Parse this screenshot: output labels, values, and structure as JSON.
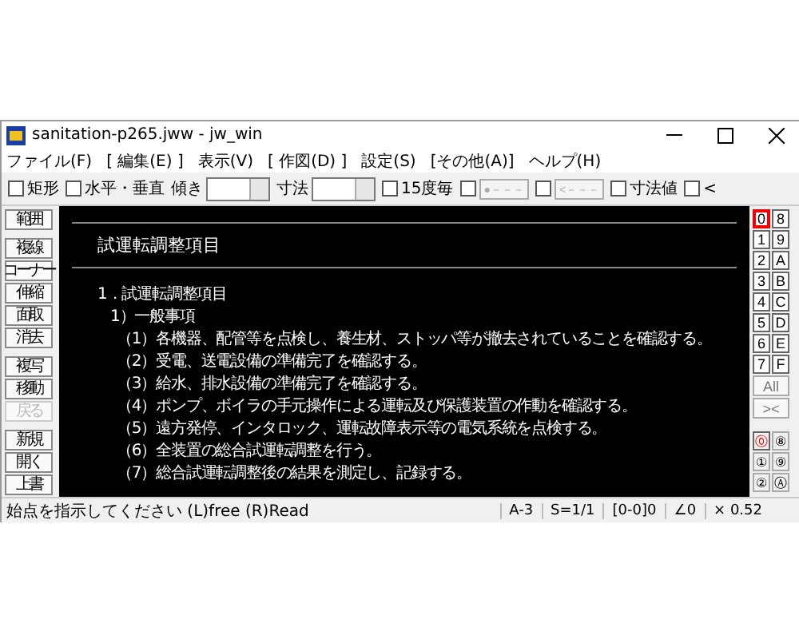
{
  "window": {
    "title": "sanitation-p265.jww - jw_win"
  },
  "menu": [
    "ファイル(F)",
    "[ 編集(E) ]",
    "表示(V)",
    "[ 作図(D) ]",
    "設定(S)",
    "[その他(A)]",
    "ヘルプ(H)"
  ],
  "toolbar": [
    {
      "kind": "check",
      "label": "矩形",
      "checked": false
    },
    {
      "kind": "check",
      "label": "水平・垂直",
      "checked": false
    },
    {
      "kind": "combo",
      "label": "傾き"
    },
    {
      "kind": "combo",
      "label": "寸法"
    },
    {
      "kind": "check",
      "label": "15度毎",
      "checked": false
    },
    {
      "kind": "checkbutton",
      "label": "●－－－",
      "checked": false,
      "disabled": true
    },
    {
      "kind": "checkbutton",
      "label": "<－－－",
      "checked": false,
      "disabled": true
    },
    {
      "kind": "check",
      "label": "寸法値",
      "checked": false
    },
    {
      "kind": "check",
      "label": "<",
      "checked": false
    }
  ],
  "tools": [
    {
      "label": "範囲",
      "disabled": false,
      "gap": false
    },
    {
      "label": "複線",
      "disabled": false,
      "gap": true
    },
    {
      "label": "コーナー",
      "disabled": false,
      "gap": false
    },
    {
      "label": "伸縮",
      "disabled": false,
      "gap": false
    },
    {
      "label": "面取",
      "disabled": false,
      "gap": false
    },
    {
      "label": "消去",
      "disabled": false,
      "gap": false
    },
    {
      "label": "複写",
      "disabled": false,
      "gap": true
    },
    {
      "label": "移動",
      "disabled": false,
      "gap": false
    },
    {
      "label": "戻る",
      "disabled": true,
      "gap": false
    },
    {
      "label": "新規",
      "disabled": false,
      "gap": true
    },
    {
      "label": "開く",
      "disabled": false,
      "gap": false
    },
    {
      "label": "上書",
      "disabled": false,
      "gap": false
    }
  ],
  "drawing": {
    "heading": "試運転調整項目",
    "lines": [
      {
        "kind": "section",
        "text": "1．試運転調整項目"
      },
      {
        "kind": "sub",
        "text": "1）一般事項"
      },
      {
        "kind": "item",
        "text": "（1）各機器、配管等を点検し、養生材、ストッパ等が撤去されていることを確認する。"
      },
      {
        "kind": "item",
        "text": "（2）受電、送電設備の準備完了を確認する。"
      },
      {
        "kind": "item",
        "text": "（3）給水、排水設備の準備完了を確認する。"
      },
      {
        "kind": "item",
        "text": "（4）ポンプ、ボイラの手元操作による運転及び保護装置の作動を確認する。"
      },
      {
        "kind": "item",
        "text": "（5）遠方発停、インタロック、運転故障表示等の電気系統を点検する。"
      },
      {
        "kind": "item",
        "text": "（6）全装置の総合試運転調整を行う。"
      },
      {
        "kind": "item",
        "text": "（7）総合試運転調整後の結果を測定し、記録する。"
      }
    ]
  },
  "layers": [
    {
      "label": "0",
      "selected": true
    },
    {
      "label": "8",
      "selected": false
    },
    {
      "label": "1",
      "selected": false
    },
    {
      "label": "9",
      "selected": false
    },
    {
      "label": "2",
      "selected": false
    },
    {
      "label": "A",
      "selected": false
    },
    {
      "label": "3",
      "selected": false
    },
    {
      "label": "B",
      "selected": false
    },
    {
      "label": "4",
      "selected": false
    },
    {
      "label": "C",
      "selected": false
    },
    {
      "label": "5",
      "selected": false
    },
    {
      "label": "D",
      "selected": false
    },
    {
      "label": "6",
      "selected": false
    },
    {
      "label": "E",
      "selected": false
    },
    {
      "label": "7",
      "selected": false
    },
    {
      "label": "F",
      "selected": false
    }
  ],
  "layer_all": "All",
  "layer_toggle": "><",
  "groups": [
    {
      "label": "⓪",
      "selected": true
    },
    {
      "label": "⑧",
      "selected": false
    },
    {
      "label": "①",
      "selected": false
    },
    {
      "label": "⑨",
      "selected": false
    },
    {
      "label": "②",
      "selected": false
    },
    {
      "label": "Ⓐ",
      "selected": false
    }
  ],
  "status_bar": {
    "message": "始点を指示してください (L)free (R)Read",
    "cells": [
      "A-3",
      "S=1/1",
      "[0-0]0",
      "∠0",
      "× 0.52"
    ]
  }
}
